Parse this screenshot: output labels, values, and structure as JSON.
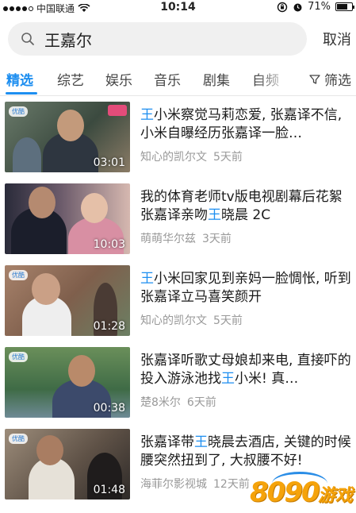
{
  "status_bar": {
    "carrier": "中国联通",
    "time": "10:14",
    "battery": "71%",
    "battery_level": 0.71
  },
  "search": {
    "query": "王嘉尔",
    "cancel_label": "取消"
  },
  "tabs": [
    {
      "label": "精选",
      "active": true
    },
    {
      "label": "综艺"
    },
    {
      "label": "娱乐"
    },
    {
      "label": "音乐"
    },
    {
      "label": "剧集"
    },
    {
      "label": "自频"
    }
  ],
  "filter_label": "筛选",
  "videos": [
    {
      "title_hl": "王",
      "title_rest": "小米察觉马莉恋爱, 张嘉译不信, 小米自曝经历张嘉译一脸…",
      "author": "知心的凯尔文",
      "time": "5天前",
      "duration": "03:01"
    },
    {
      "title_pre": "我的体育老师tv版电视剧幕后花絮 张嘉译亲吻",
      "title_hl": "王",
      "title_rest": "晓晨 2C",
      "author": "萌萌华尔兹",
      "time": "3天前",
      "duration": "10:03"
    },
    {
      "title_hl": "王",
      "title_rest": "小米回家见到亲妈一脸惆怅, 听到张嘉译立马喜笑颜开",
      "author": "知心的凯尔文",
      "time": "5天前",
      "duration": "01:28"
    },
    {
      "title_pre": "张嘉译听歌丈母娘却来电, 直接吓的投入游泳池找",
      "title_hl": "王",
      "title_rest": "小米! 真…",
      "author": "楚8米尔",
      "time": "6天前",
      "duration": "00:38"
    },
    {
      "title_pre": "张嘉译带",
      "title_hl": "王",
      "title_rest": "晓晨去酒店, 关键的时候腰突然扭到了, 大叔腰不好!",
      "author": "海菲尔影视城",
      "time": "12天前",
      "duration": "01:48"
    }
  ],
  "watermark": {
    "digits": "8090",
    "text": "游戏"
  },
  "colors": {
    "accent": "#1d8ef0",
    "meta_text": "#999999",
    "logo_orange": "#f5a30b"
  }
}
